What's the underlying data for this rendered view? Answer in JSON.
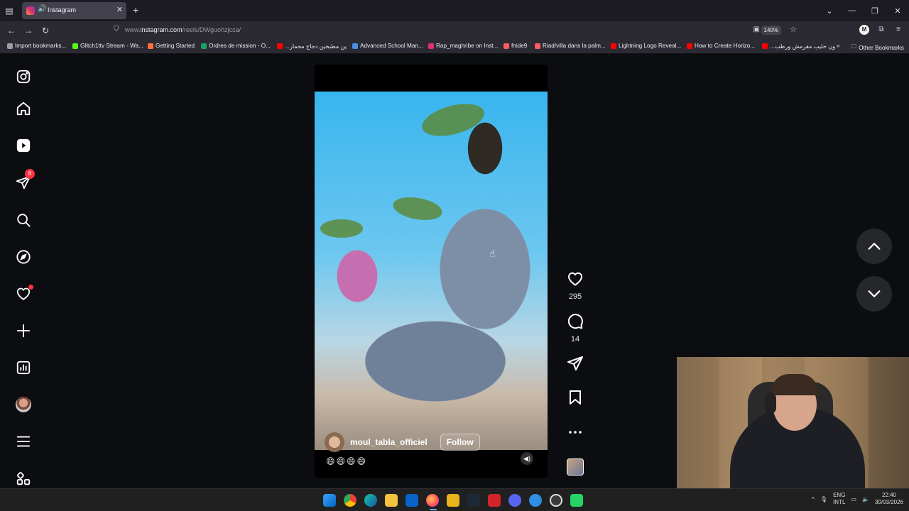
{
  "browser": {
    "tab": {
      "title": "Instagram",
      "audio_icon": "speaker-icon",
      "close": "✕"
    },
    "new_tab": "+",
    "window_controls": [
      "⌄",
      "—",
      "❐",
      "✕"
    ],
    "url": {
      "prefix": "www.",
      "domain": "instagram.com",
      "path": "/reels/DWguohzjcca/"
    },
    "zoom": "140%",
    "bookmarks": [
      {
        "label": "Import bookmarks...",
        "color": "#9aa0a6"
      },
      {
        "label": "Glitch1ttv Stream - Wa...",
        "color": "#53fc18"
      },
      {
        "label": "Getting Started",
        "color": "#ff7139"
      },
      {
        "label": "Ordres de mission - O...",
        "color": "#1aa260"
      },
      {
        "label": "...ين مطبخين دجاج محمار",
        "color": "#ff0000"
      },
      {
        "label": "Advanced School Man...",
        "color": "#4a90e2"
      },
      {
        "label": "Rap_maghribe on Inst...",
        "color": "#e1306c"
      },
      {
        "label": "fnide9",
        "color": "#ff5a5f"
      },
      {
        "label": "Riad/villa dans la palm...",
        "color": "#ff5a5f"
      },
      {
        "label": "Lightning Logo Reveal...",
        "color": "#ff0000"
      },
      {
        "label": "How to Create Horizo...",
        "color": "#ff0000"
      },
      {
        "label": "...ون حليب مقرمش ورطب",
        "color": "#ff0000"
      }
    ],
    "bookmarks_overflow": "»",
    "other_bookmarks": "Other Bookmarks"
  },
  "sidebar": {
    "items": [
      {
        "name": "instagram-logo-icon"
      },
      {
        "name": "home-icon"
      },
      {
        "name": "reels-icon"
      },
      {
        "name": "direct-messages-icon",
        "badge": "8"
      },
      {
        "name": "search-icon"
      },
      {
        "name": "explore-icon"
      },
      {
        "name": "notifications-heart-icon"
      },
      {
        "name": "create-plus-icon"
      },
      {
        "name": "insights-chart-icon"
      },
      {
        "name": "profile-avatar"
      },
      {
        "name": "more-menu-icon"
      },
      {
        "name": "also-from-meta-icon"
      }
    ]
  },
  "reel": {
    "username": "moul_tabla_officiel",
    "follow_label": "Follow",
    "caption": "😄😄😄😄",
    "likes": "295",
    "comments": "14"
  },
  "taskbar": {
    "language": "ENG",
    "layout": "INTL",
    "time": "22:40",
    "date": "30/03/2026",
    "tray_arrow": "^"
  }
}
